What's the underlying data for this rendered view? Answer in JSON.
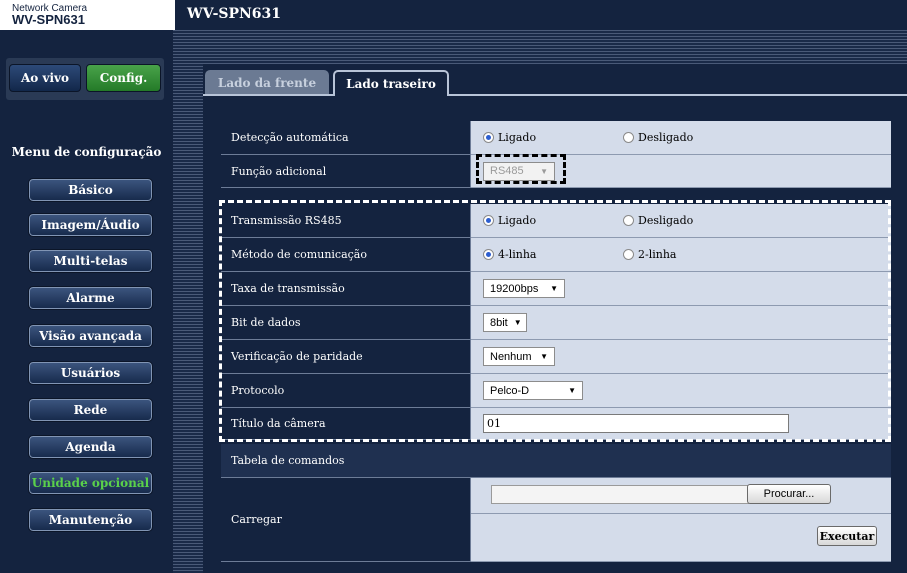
{
  "brand": {
    "small": "Network Camera",
    "model": "WV-SPN631"
  },
  "header": {
    "title": "WV-SPN631"
  },
  "mode": {
    "live": "Ao vivo",
    "config": "Config."
  },
  "menu": {
    "title": "Menu de configuração",
    "items": [
      {
        "label": "Básico"
      },
      {
        "label": "Imagem/Áudio"
      },
      {
        "label": "Multi-telas"
      },
      {
        "label": "Alarme"
      },
      {
        "label": "Visão avançada"
      },
      {
        "label": "Usuários"
      },
      {
        "label": "Rede"
      },
      {
        "label": "Agenda"
      },
      {
        "label": "Unidade opcional",
        "active": true
      },
      {
        "label": "Manutenção"
      }
    ]
  },
  "tabs": {
    "front": "Lado da frente",
    "back": "Lado traseiro"
  },
  "settings": {
    "auto_detect": {
      "label": "Detecção automática",
      "opt_on": "Ligado",
      "opt_off": "Desligado",
      "selected": "Ligado"
    },
    "extra_function": {
      "label": "Função adicional",
      "value": "RS485"
    },
    "rs485_tx": {
      "label": "Transmissão RS485",
      "opt_on": "Ligado",
      "opt_off": "Desligado",
      "selected": "Ligado"
    },
    "comm_method": {
      "label": "Método de comunicação",
      "opt_a": "4-linha",
      "opt_b": "2-linha",
      "selected": "4-linha"
    },
    "baud_rate": {
      "label": "Taxa de transmissão",
      "value": "19200bps"
    },
    "data_bits": {
      "label": "Bit de dados",
      "value": "8bit"
    },
    "parity": {
      "label": "Verificação de paridade",
      "value": "Nenhum"
    },
    "protocol": {
      "label": "Protocolo",
      "value": "Pelco-D"
    },
    "camera_title": {
      "label": "Título da câmera",
      "value": "01"
    }
  },
  "command_table": {
    "header": "Tabela de comandos",
    "upload_label": "Carregar",
    "file_value": "",
    "browse": "Procurar...",
    "execute": "Executar"
  },
  "colors": {
    "navy": "#14233f",
    "panel_value": "#d4dcea",
    "active_menu": "#5ad14a",
    "config_green": "#49a34a"
  }
}
